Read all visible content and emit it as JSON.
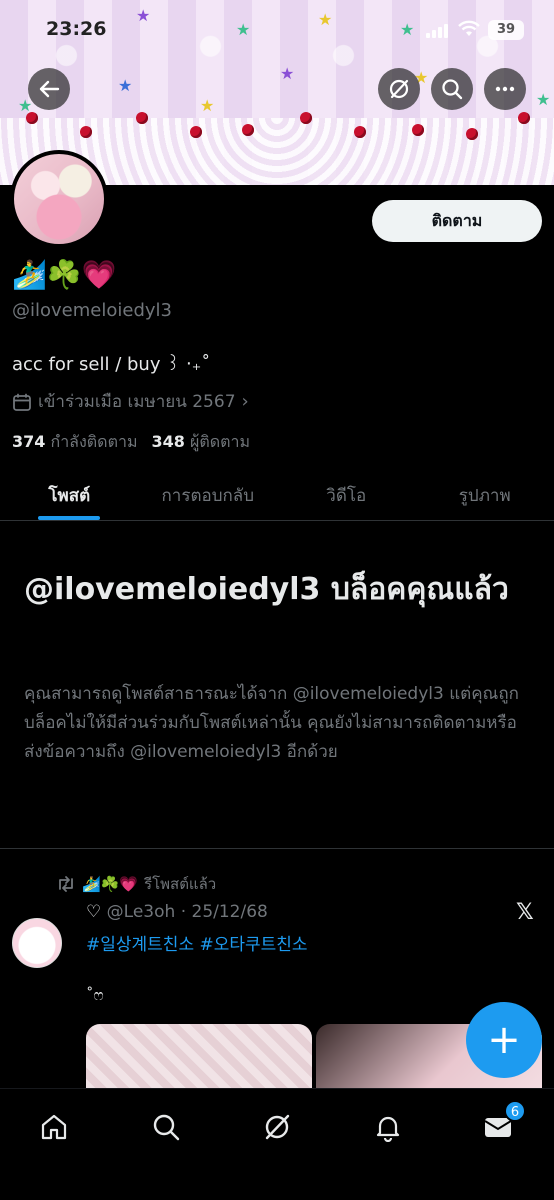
{
  "status_bar": {
    "time": "23:26",
    "battery": "39"
  },
  "profile": {
    "display_name": "🏄‍♂️☘️💗",
    "handle": "@ilovemeloiedyl3",
    "bio": "acc for sell / buy ꒱ ‧₊˚",
    "joined": "เข้าร่วมเมือ เมษายน 2567",
    "following_count": "374",
    "following_label": "กำลังติดตาม",
    "followers_count": "348",
    "followers_label": "ผู้ติดตาม",
    "follow_button": "ติดตาม"
  },
  "tabs": [
    {
      "label": "โพสต์"
    },
    {
      "label": "การตอบกลับ"
    },
    {
      "label": "วิดีโอ"
    },
    {
      "label": "รูปภาพ"
    }
  ],
  "blocked": {
    "title": "@ilovemeloiedyl3 บล็อคคุณแล้ว",
    "description": "คุณสามารถดูโพสต์สาธารณะได้จาก @ilovemeloiedyl3 แต่คุณถูกบล็อคไม่ให้มีส่วนร่วมกับโพสต์เหล่านั้น คุณยังไม่สามารถติดตามหรือส่งข้อความถึง @ilovemeloiedyl3 อีกด้วย"
  },
  "post": {
    "repost_by": "🏄‍♂️☘️💗",
    "repost_label": "รีโพสต์แล้ว",
    "author_name": "♡",
    "author_handle": "@Le3oh",
    "date": "25/12/68",
    "hashtags": "#일상계트친소 #오타쿠트친소",
    "text": "˚ෆ"
  },
  "nav": {
    "messages_badge": "6"
  }
}
